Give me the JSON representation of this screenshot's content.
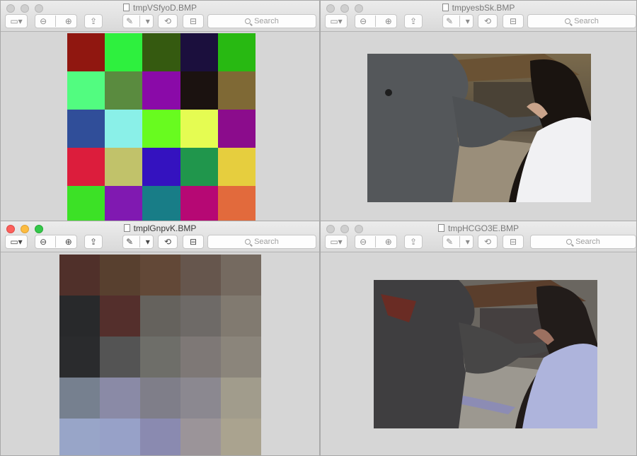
{
  "windows": [
    {
      "title": "tmpVSfyoD.BMP",
      "active": false,
      "search_placeholder": "Search",
      "image_type": "color-grid",
      "grid_cols": 5,
      "grid_rows": 5,
      "colors": [
        "#901710",
        "#2ef03e",
        "#355a10",
        "#1b0f3d",
        "#28b912",
        "#52fc80",
        "#5a8b3f",
        "#8a0aa8",
        "#1b1210",
        "#7f6935",
        "#304e99",
        "#8af0e8",
        "#68fb1f",
        "#e5fc52",
        "#8b0c8c",
        "#dc1d3c",
        "#c1c26a",
        "#3412bf",
        "#20964c",
        "#e6ce3e",
        "#3ce126",
        "#8019b1",
        "#187d87",
        "#b60874",
        "#e26a3c"
      ]
    },
    {
      "title": "tmpyesbSk.BMP",
      "active": false,
      "search_placeholder": "Search",
      "image_type": "photo-elephant"
    },
    {
      "title": "tmplGnpvK.BMP",
      "active": true,
      "search_placeholder": "Search",
      "image_type": "color-grid",
      "grid_cols": 5,
      "grid_rows": 5,
      "colors": [
        "#50302a",
        "#58402f",
        "#624837",
        "#66564d",
        "#756a60",
        "#28292b",
        "#542f2c",
        "#65625d",
        "#6e6a67",
        "#817a70",
        "#2a2b2d",
        "#545454",
        "#6e6e69",
        "#7e7876",
        "#8b857b",
        "#76808f",
        "#8a8aa6",
        "#7f7e89",
        "#8b8890",
        "#a19c8c",
        "#98a5c8",
        "#97a1c8",
        "#8a8ab0",
        "#9b9499",
        "#aaa38f"
      ]
    },
    {
      "title": "tmpHCGO3E.BMP",
      "active": false,
      "search_placeholder": "Search",
      "image_type": "photo-elephant-posterized"
    }
  ]
}
